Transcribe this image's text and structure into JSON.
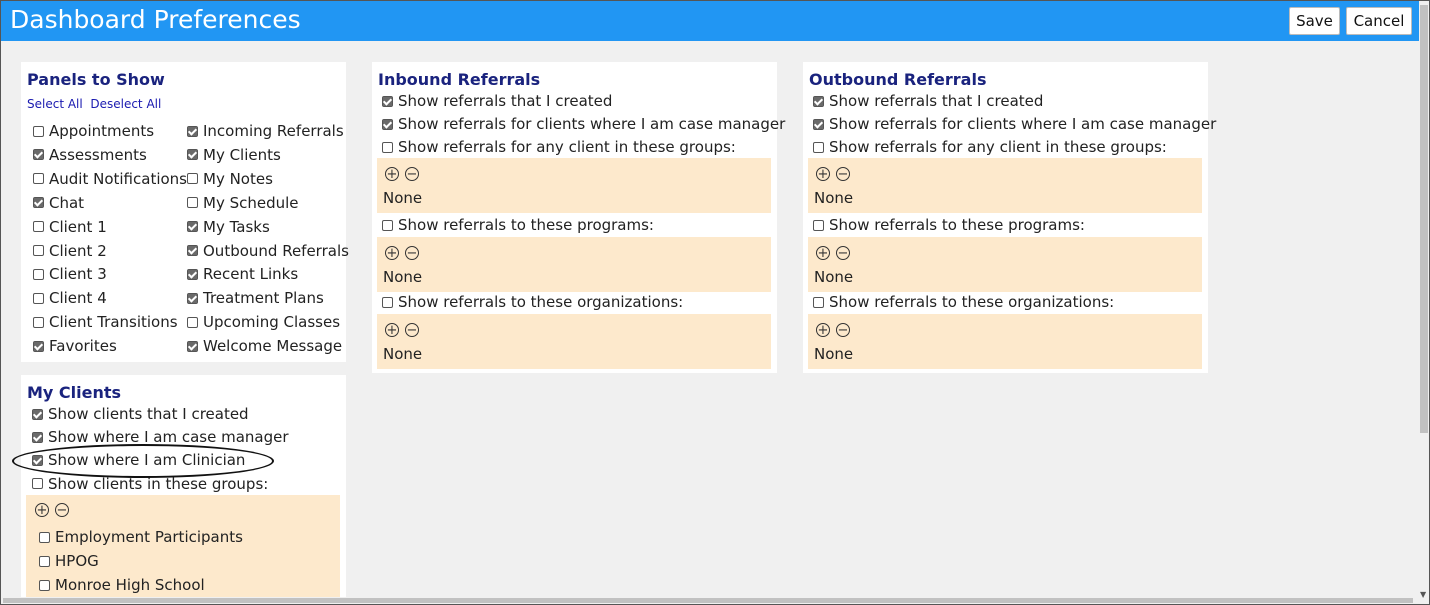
{
  "header": {
    "title": "Dashboard Preferences",
    "save_label": "Save",
    "cancel_label": "Cancel"
  },
  "panels_to_show": {
    "title": "Panels to Show",
    "select_all": "Select All",
    "deselect_all": "Deselect All",
    "left": [
      {
        "label": "Appointments",
        "checked": false
      },
      {
        "label": "Assessments",
        "checked": true
      },
      {
        "label": "Audit Notifications",
        "checked": false
      },
      {
        "label": "Chat",
        "checked": true
      },
      {
        "label": "Client 1",
        "checked": false
      },
      {
        "label": "Client 2",
        "checked": false
      },
      {
        "label": "Client 3",
        "checked": false
      },
      {
        "label": "Client 4",
        "checked": false
      },
      {
        "label": "Client Transitions",
        "checked": false
      },
      {
        "label": "Favorites",
        "checked": true
      }
    ],
    "right": [
      {
        "label": "Incoming Referrals",
        "checked": true
      },
      {
        "label": "My Clients",
        "checked": true
      },
      {
        "label": "My Notes",
        "checked": false
      },
      {
        "label": "My Schedule",
        "checked": false
      },
      {
        "label": "My Tasks",
        "checked": true
      },
      {
        "label": "Outbound Referrals",
        "checked": true
      },
      {
        "label": "Recent Links",
        "checked": true
      },
      {
        "label": "Treatment Plans",
        "checked": true
      },
      {
        "label": "Upcoming Classes",
        "checked": false
      },
      {
        "label": "Welcome Message",
        "checked": true
      }
    ]
  },
  "my_clients": {
    "title": "My Clients",
    "options": [
      {
        "label": "Show clients that I created",
        "checked": true
      },
      {
        "label": "Show where I am case manager",
        "checked": true
      },
      {
        "label": "Show where I am Clinician",
        "checked": true
      },
      {
        "label": "Show clients in these groups:",
        "checked": false
      }
    ],
    "groups": [
      {
        "label": "Employment Participants",
        "checked": false
      },
      {
        "label": "HPOG",
        "checked": false
      },
      {
        "label": "Monroe High School",
        "checked": false
      }
    ]
  },
  "inbound": {
    "title": "Inbound Referrals",
    "created": {
      "label": "Show referrals that I created",
      "checked": true
    },
    "case_manager": {
      "label": "Show referrals for clients where I am case manager",
      "checked": true
    },
    "groups": {
      "label": "Show referrals for any client in these groups:",
      "checked": false,
      "value": "None"
    },
    "programs": {
      "label": "Show referrals to these programs:",
      "checked": false,
      "value": "None"
    },
    "organizations": {
      "label": "Show referrals to these organizations:",
      "checked": false,
      "value": "None"
    }
  },
  "outbound": {
    "title": "Outbound Referrals",
    "created": {
      "label": "Show referrals that I created",
      "checked": true
    },
    "case_manager": {
      "label": "Show referrals for clients where I am case manager",
      "checked": true
    },
    "groups": {
      "label": "Show referrals for any client in these groups:",
      "checked": false,
      "value": "None"
    },
    "programs": {
      "label": "Show referrals to these programs:",
      "checked": false,
      "value": "None"
    },
    "organizations": {
      "label": "Show referrals to these organizations:",
      "checked": false,
      "value": "None"
    }
  },
  "icons": {
    "add": "plus-circle-icon",
    "remove": "minus-circle-icon"
  },
  "colors": {
    "header": "#2196f3",
    "group_bg": "#fde9cc",
    "title": "#1a237e"
  }
}
